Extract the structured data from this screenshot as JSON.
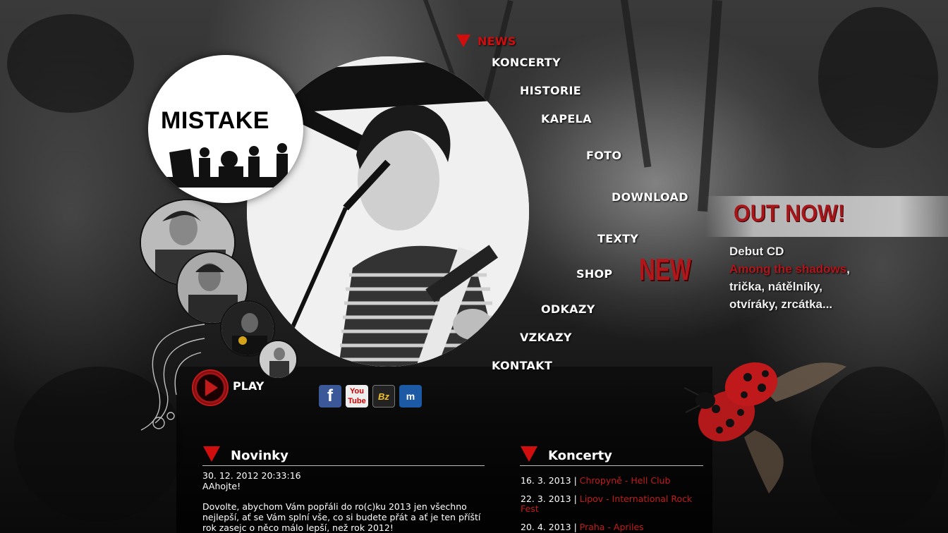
{
  "logo": {
    "text": "MISTAKE"
  },
  "nav": {
    "news": "NEWS",
    "items": [
      "KONCERTY",
      "HISTORIE",
      "KAPELA",
      "FOTO",
      "DOWNLOAD",
      "TEXTY",
      "SHOP",
      "ODKAZY",
      "VZKAZY",
      "KONTAKT"
    ]
  },
  "badge": {
    "new": "NEW"
  },
  "promo": {
    "out_now": "OUT NOW!",
    "line1": "Debut CD",
    "album": "Among the shadows",
    "line2_suffix": ",",
    "line3": "trička, nátělníky,",
    "line4": "otvíráky, zrcátka..."
  },
  "player": {
    "play_label": "PLAY"
  },
  "social": [
    {
      "name": "facebook",
      "label": "f"
    },
    {
      "name": "youtube",
      "label": "You Tube"
    },
    {
      "name": "bandzone",
      "label": "Bz"
    },
    {
      "name": "myspace",
      "label": "m"
    }
  ],
  "news": {
    "title": "Novinky",
    "date": "30. 12. 2012 20:33:16",
    "greeting": "AAhojte!",
    "body": "Dovolte, abychom Vám popřáli do ro(c)ku 2013 jen všechno nejlepší, ať se Vám splní vše, co si budete přát a ať je ten příští rok zasejc o něco málo lepší, než rok 2012!"
  },
  "concerts": {
    "title": "Koncerty",
    "items": [
      {
        "date": "16. 3. 2013",
        "sep": "|",
        "place": "Chropyně - Hell Club"
      },
      {
        "date": "22. 3. 2013",
        "sep": "|",
        "place": "Lipov - International Rock Fest"
      },
      {
        "date": "20. 4. 2013",
        "sep": "|",
        "place": "Praha - Apriles"
      }
    ]
  },
  "colors": {
    "accent": "#c41a1a",
    "text": "#ffffff",
    "background": "#1a1a1a"
  }
}
